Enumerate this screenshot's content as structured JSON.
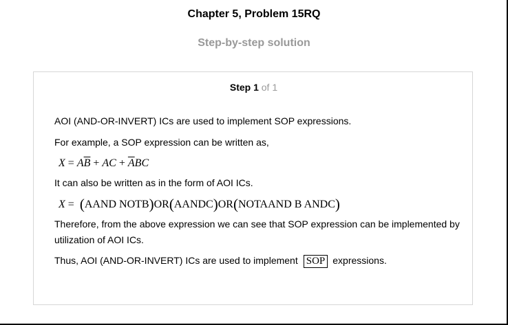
{
  "header": {
    "chapter_title": "Chapter 5, Problem 15RQ",
    "subtitle": "Step-by-step solution"
  },
  "step": {
    "label": "Step 1",
    "of": "of 1"
  },
  "content": {
    "p1": "AOI (AND-OR-INVERT) ICs are used to implement SOP expressions.",
    "p2": "For example, a SOP expression can be written as,",
    "eq1": {
      "lhs": "X",
      "eq": "=",
      "t1a": "A",
      "t1b": "B",
      "plus1": "+",
      "t2": "AC",
      "plus2": "+",
      "t3a": "A",
      "t3b": "BC"
    },
    "p3": "It can also be written as in the form of AOI ICs.",
    "eq2": {
      "lhs": "X",
      "eq": "=",
      "g1": "AAND NOTB",
      "or1": "OR",
      "g2": "AANDC",
      "or2": "OR",
      "g3": "NOTAAND B ANDC"
    },
    "p4": "Therefore, from the above expression we can see that SOP expression can be implemented by utilization of AOI ICs.",
    "p5_before": "Thus, AOI (AND-OR-INVERT) ICs are used to implement",
    "p5_boxed": "SOP",
    "p5_after": "expressions."
  }
}
